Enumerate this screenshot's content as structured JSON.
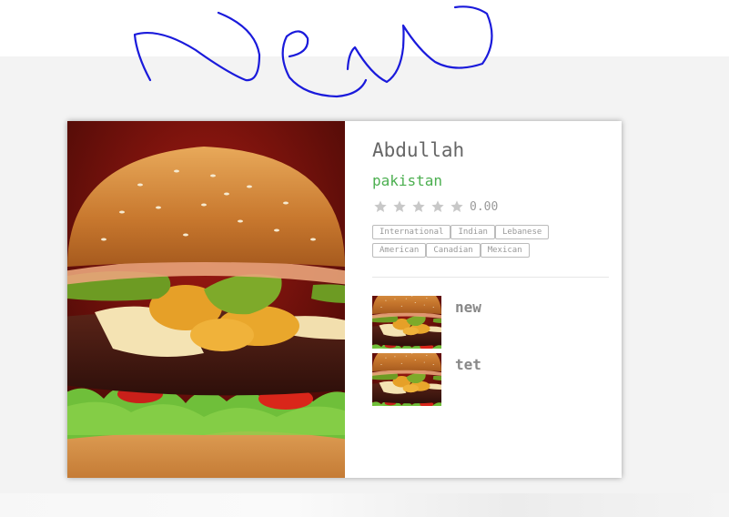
{
  "restaurant": {
    "name": "Abdullah",
    "country": "pakistan",
    "rating": "0.00",
    "stars_filled": 0,
    "cuisines": [
      "International",
      "Indian",
      "Lebanese",
      "American",
      "Canadian",
      "Mexican"
    ]
  },
  "menu_items": [
    {
      "label": "new",
      "image_icon": "burger-photo"
    },
    {
      "label": "tet",
      "image_icon": "burger-photo"
    }
  ],
  "colors": {
    "accent_green": "#4caf50",
    "page_grey": "#f3f3f3",
    "scribble_blue": "#1a1adb"
  },
  "annotation": {
    "handwritten_text": "New"
  }
}
